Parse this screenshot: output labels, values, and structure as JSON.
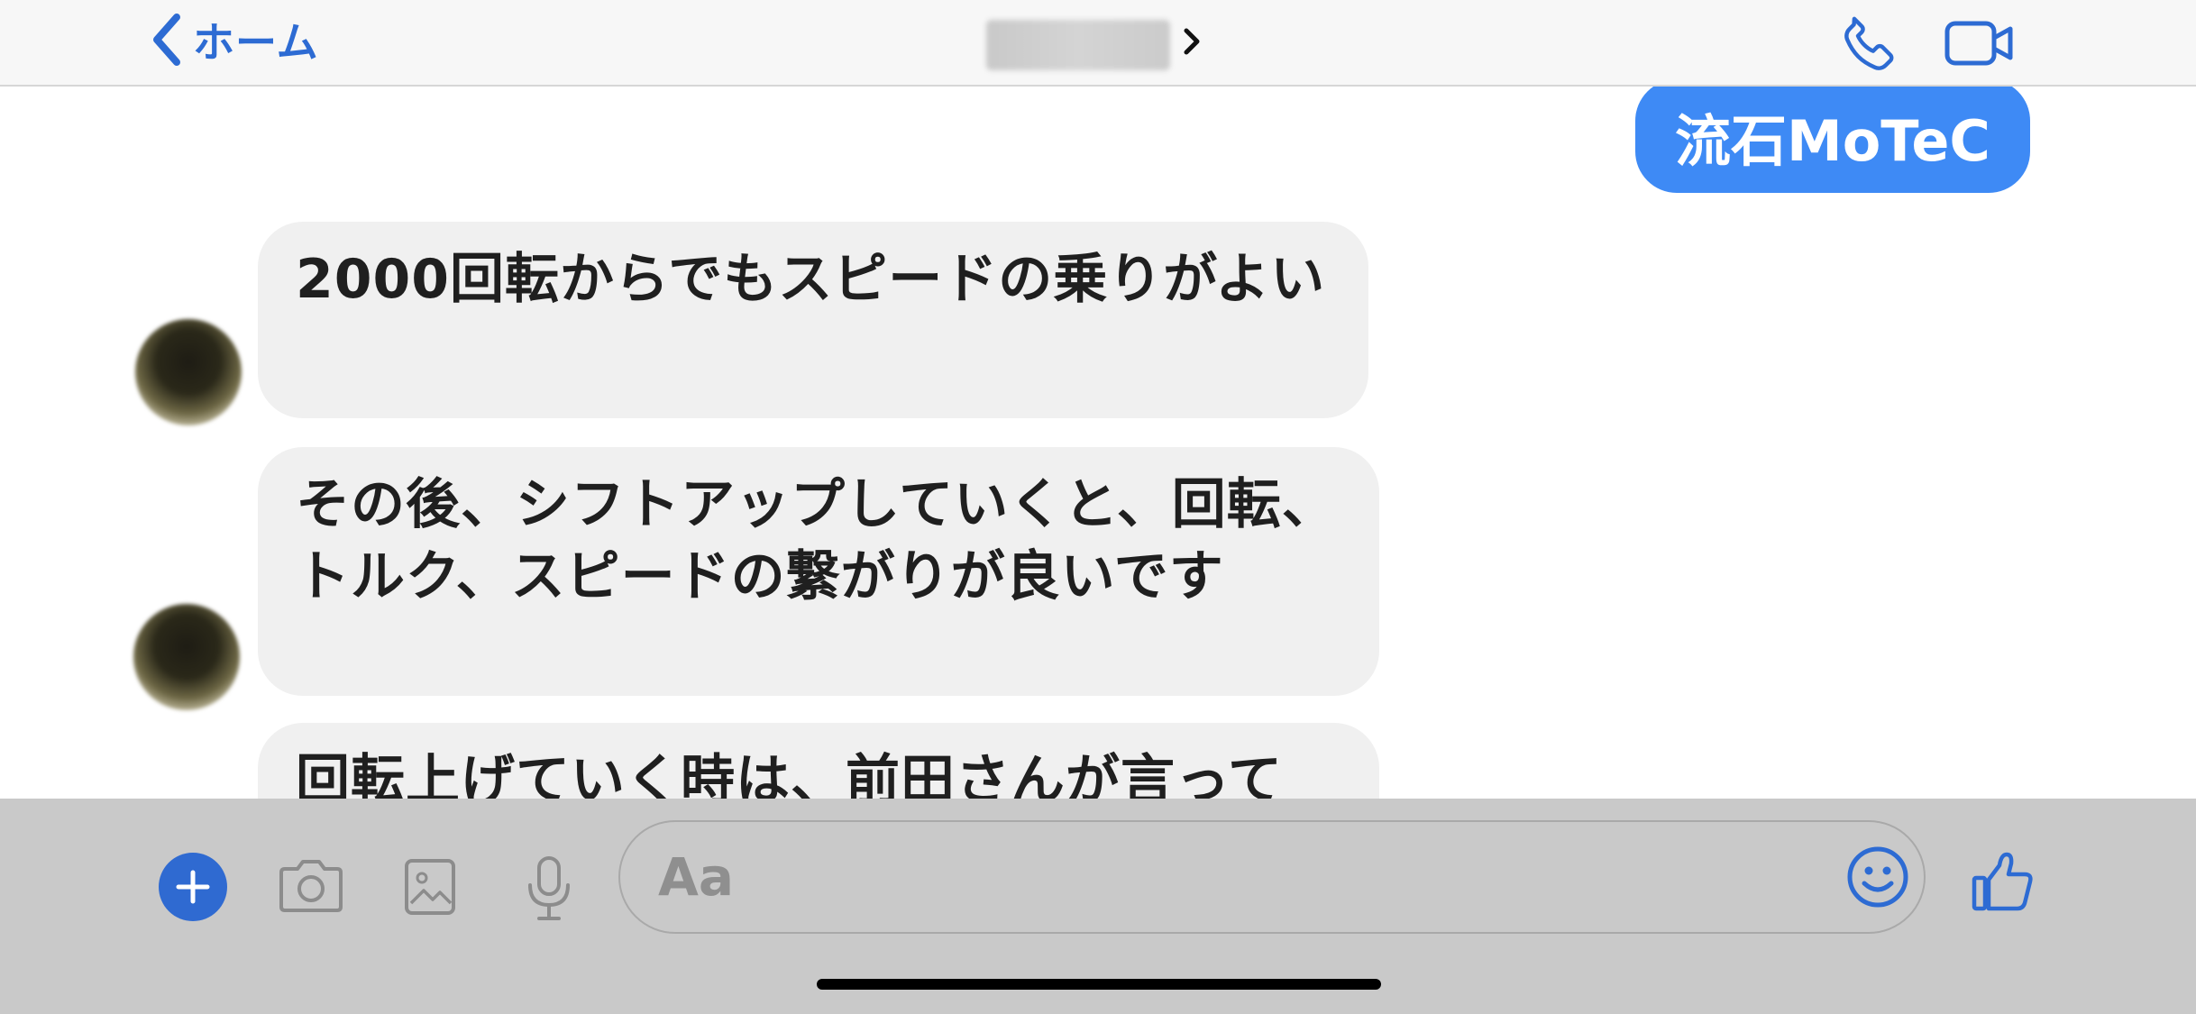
{
  "header": {
    "back_label": "ホーム",
    "contact_name": ""
  },
  "messages": [
    {
      "direction": "outgoing",
      "text": "流石MoTeC"
    },
    {
      "direction": "incoming",
      "text": "2000回転からでもスピードの乗りがよい"
    },
    {
      "direction": "incoming",
      "text": "その後、シフトアップしていくと、回転、トルク、スピードの繋がりが良いです"
    },
    {
      "direction": "incoming",
      "text": "回転上げていく時は、前田さんが言って"
    }
  ],
  "composer": {
    "input_placeholder": "Aa",
    "input_value": ""
  },
  "icons": {
    "back": "chevron-left-icon",
    "contact_chevron": "chevron-right-icon",
    "phone": "phone-icon",
    "video": "video-camera-icon",
    "plus": "plus-icon",
    "camera": "camera-icon",
    "photo": "photo-icon",
    "mic": "microphone-icon",
    "emoji": "smiley-icon",
    "like": "thumbs-up-icon"
  },
  "colors": {
    "accent": "#2d6bd3",
    "outgoing_bubble": "#3e8af5",
    "incoming_bubble": "#f0f0f0",
    "composer_background": "#c9c9c9"
  }
}
